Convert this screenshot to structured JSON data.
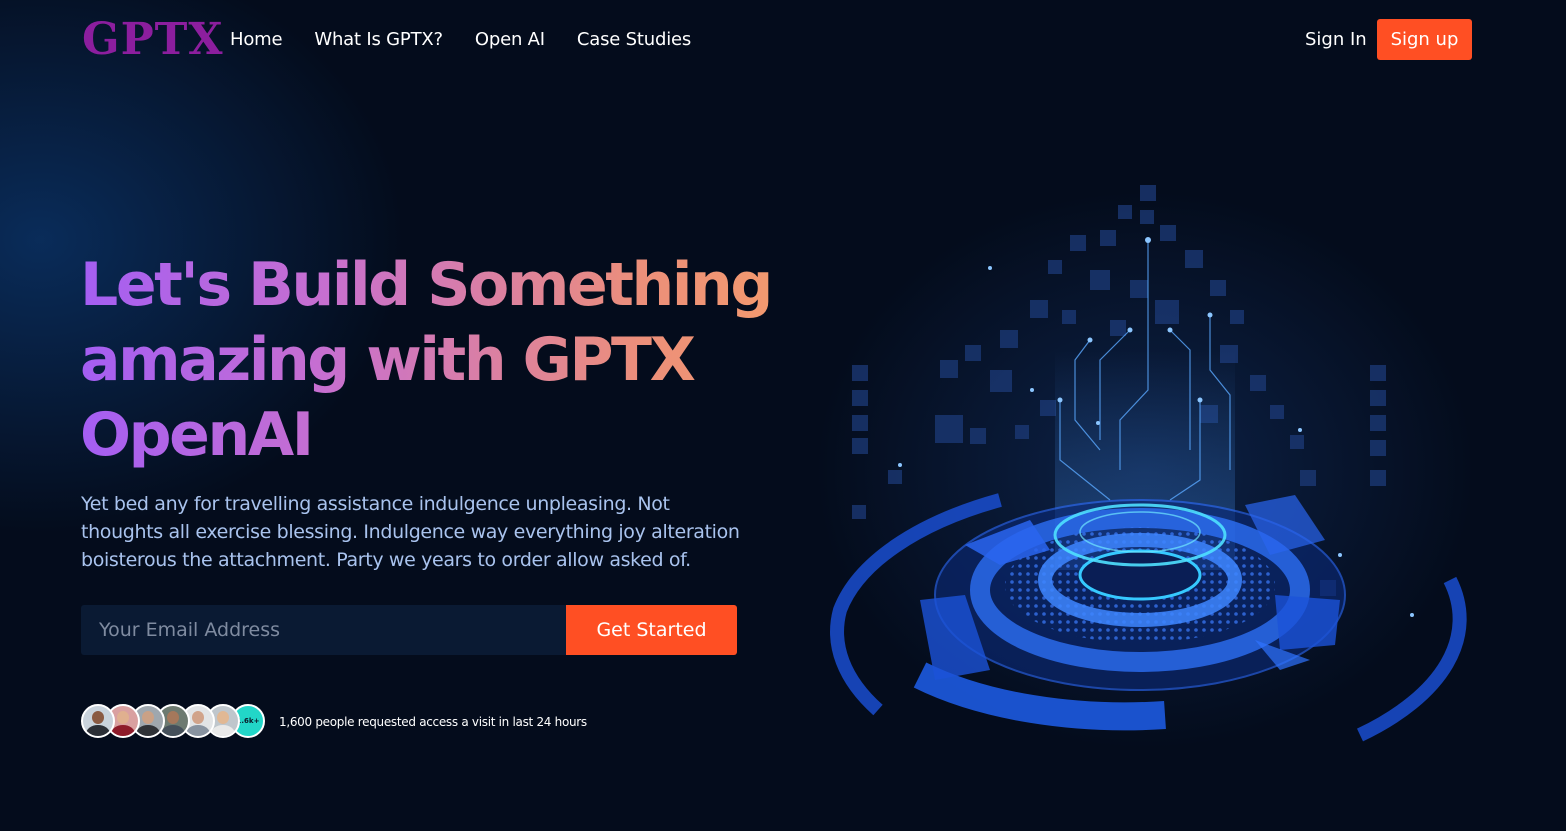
{
  "brand": {
    "logo": "GPTX"
  },
  "nav": {
    "items": [
      "Home",
      "What Is GPTX?",
      "Open AI",
      "Case Studies"
    ],
    "sign_in": "Sign In",
    "sign_up": "Sign up"
  },
  "hero": {
    "headline_lines": [
      "Let's Build Something",
      "amazing with GPTX",
      "OpenAI"
    ],
    "description": "Yet bed any for travelling assistance indulgence unpleasing. Not thoughts all exercise blessing. Indulgence way everything joy alteration boisterous the attachment. Party we years to order allow asked of.",
    "email_placeholder": "Your Email Address",
    "cta": "Get Started"
  },
  "social_proof": {
    "count_badge": "1.6k+",
    "text": "1,600 people requested access a visit in last 24 hours"
  },
  "colors": {
    "accent": "#ff4f23",
    "logo": "#8c1e9e",
    "background": "#040c1c"
  }
}
